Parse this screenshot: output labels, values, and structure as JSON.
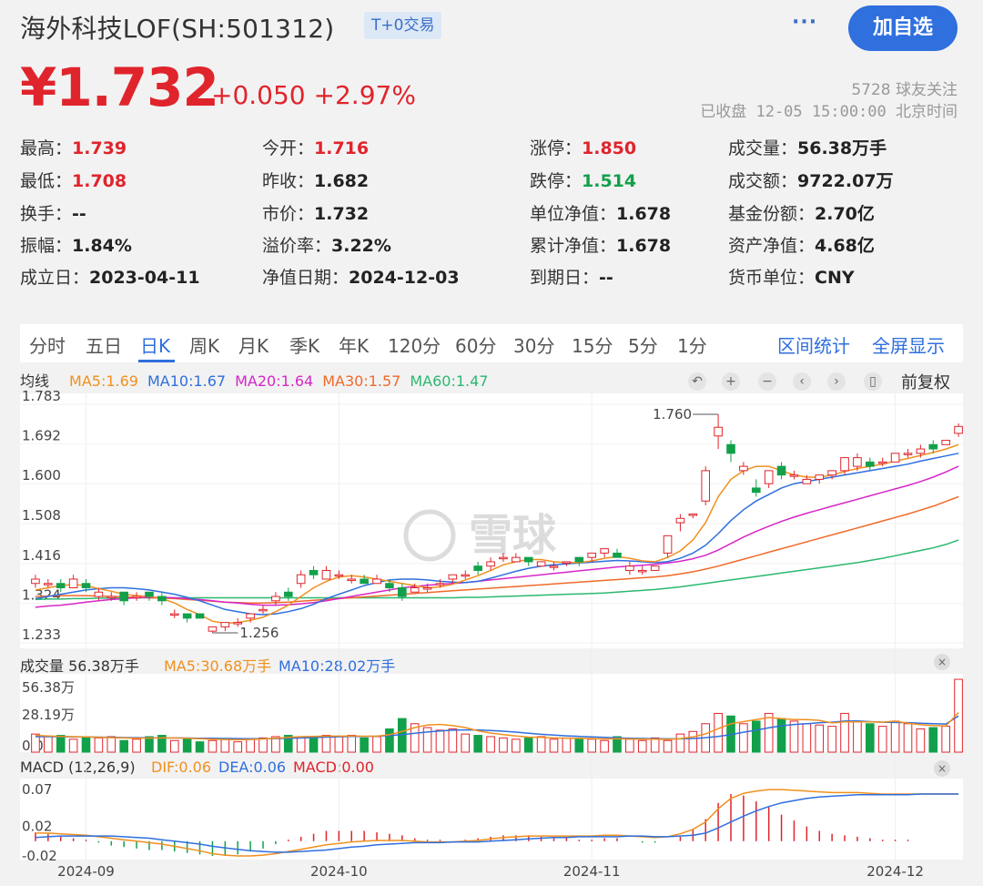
{
  "header": {
    "title": "海外科技LOF(SH:501312)",
    "badge": "T+0交易",
    "more_label": "···",
    "follow_label": "加自选"
  },
  "quote": {
    "price": "¥1.732",
    "change": "+0.050",
    "change_pct": "+2.97%",
    "followers": "5728 球友关注",
    "status": "已收盘 12-05 15:00:00 北京时间"
  },
  "stats": [
    [
      {
        "k": "最高：",
        "v": "1.739",
        "c": "red"
      },
      {
        "k": "今开：",
        "v": "1.716",
        "c": "red"
      },
      {
        "k": "涨停：",
        "v": "1.850",
        "c": "red"
      },
      {
        "k": "成交量：",
        "v": "56.38万手",
        "c": ""
      }
    ],
    [
      {
        "k": "最低：",
        "v": "1.708",
        "c": "red"
      },
      {
        "k": "昨收：",
        "v": "1.682",
        "c": ""
      },
      {
        "k": "跌停：",
        "v": "1.514",
        "c": "green"
      },
      {
        "k": "成交额：",
        "v": "9722.07万",
        "c": ""
      }
    ],
    [
      {
        "k": "换手：",
        "v": "--",
        "c": ""
      },
      {
        "k": "市价：",
        "v": "1.732",
        "c": ""
      },
      {
        "k": "单位净值：",
        "v": "1.678",
        "c": ""
      },
      {
        "k": "基金份额：",
        "v": "2.70亿",
        "c": ""
      }
    ],
    [
      {
        "k": "振幅：",
        "v": "1.84%",
        "c": ""
      },
      {
        "k": "溢价率：",
        "v": "3.22%",
        "c": ""
      },
      {
        "k": "累计净值：",
        "v": "1.678",
        "c": ""
      },
      {
        "k": "资产净值：",
        "v": "4.68亿",
        "c": ""
      }
    ],
    [
      {
        "k": "成立日：",
        "v": "2023-04-11",
        "c": ""
      },
      {
        "k": "净值日期：",
        "v": "2024-12-03",
        "c": ""
      },
      {
        "k": "到期日：",
        "v": "--",
        "c": ""
      },
      {
        "k": "货币单位：",
        "v": "CNY",
        "c": ""
      }
    ]
  ],
  "tabs": [
    "分时",
    "五日",
    "日K",
    "周K",
    "月K",
    "季K",
    "年K",
    "120分",
    "60分",
    "30分",
    "15分",
    "5分",
    "1分"
  ],
  "active_tab": "日K",
  "links": {
    "range_stats": "区间统计",
    "fullscreen": "全屏显示"
  },
  "ma_legend": {
    "label": "均线",
    "items": [
      {
        "text": "MA5:1.69",
        "color": "#f0901e"
      },
      {
        "text": "MA10:1.67",
        "color": "#2f6fde"
      },
      {
        "text": "MA20:1.64",
        "color": "#d627c8"
      },
      {
        "text": "MA30:1.57",
        "color": "#f06a2a"
      },
      {
        "text": "MA60:1.47",
        "color": "#2cb870"
      }
    ]
  },
  "controls": {
    "fq_label": "前复权",
    "icons": [
      "undo-icon",
      "zoom-in-icon",
      "zoom-out-icon",
      "pan-left-icon",
      "pan-right-icon",
      "candle-type-icon"
    ]
  },
  "watermark": "雪球",
  "chart_data": {
    "type": "candlestick",
    "y_ticks": [
      "1.783",
      "1.692",
      "1.600",
      "1.508",
      "1.416",
      "1.324",
      "1.233"
    ],
    "ylim": [
      1.233,
      1.783
    ],
    "x_ticks": [
      "2024-09",
      "2024-10",
      "2024-11",
      "2024-12"
    ],
    "annotations": {
      "high": "1.760",
      "low": "1.256"
    },
    "candles": [
      [
        1.37,
        1.38,
        1.36,
        1.39
      ],
      [
        1.37,
        1.37,
        1.36,
        1.38
      ],
      [
        1.37,
        1.36,
        1.35,
        1.38
      ],
      [
        1.36,
        1.38,
        1.36,
        1.39
      ],
      [
        1.37,
        1.36,
        1.35,
        1.38
      ],
      [
        1.34,
        1.35,
        1.33,
        1.36
      ],
      [
        1.34,
        1.34,
        1.33,
        1.35
      ],
      [
        1.35,
        1.33,
        1.32,
        1.35
      ],
      [
        1.34,
        1.34,
        1.33,
        1.35
      ],
      [
        1.35,
        1.34,
        1.33,
        1.35
      ],
      [
        1.34,
        1.33,
        1.32,
        1.35
      ],
      [
        1.3,
        1.3,
        1.29,
        1.31
      ],
      [
        1.3,
        1.29,
        1.28,
        1.3
      ],
      [
        1.3,
        1.29,
        1.29,
        1.3
      ],
      [
        1.26,
        1.27,
        1.256,
        1.27
      ],
      [
        1.27,
        1.28,
        1.26,
        1.28
      ],
      [
        1.28,
        1.28,
        1.27,
        1.29
      ],
      [
        1.29,
        1.3,
        1.28,
        1.3
      ],
      [
        1.31,
        1.31,
        1.3,
        1.32
      ],
      [
        1.33,
        1.34,
        1.32,
        1.35
      ],
      [
        1.35,
        1.34,
        1.33,
        1.36
      ],
      [
        1.37,
        1.39,
        1.36,
        1.4
      ],
      [
        1.4,
        1.39,
        1.38,
        1.41
      ],
      [
        1.38,
        1.4,
        1.38,
        1.41
      ],
      [
        1.39,
        1.39,
        1.38,
        1.4
      ],
      [
        1.38,
        1.38,
        1.37,
        1.39
      ],
      [
        1.38,
        1.37,
        1.37,
        1.39
      ],
      [
        1.37,
        1.38,
        1.37,
        1.39
      ],
      [
        1.37,
        1.36,
        1.35,
        1.38
      ],
      [
        1.36,
        1.34,
        1.33,
        1.37
      ],
      [
        1.35,
        1.36,
        1.35,
        1.37
      ],
      [
        1.36,
        1.36,
        1.35,
        1.37
      ],
      [
        1.37,
        1.37,
        1.36,
        1.38
      ],
      [
        1.38,
        1.39,
        1.37,
        1.39
      ],
      [
        1.39,
        1.39,
        1.38,
        1.4
      ],
      [
        1.41,
        1.4,
        1.39,
        1.42
      ],
      [
        1.41,
        1.42,
        1.4,
        1.43
      ],
      [
        1.43,
        1.43,
        1.42,
        1.44
      ],
      [
        1.42,
        1.43,
        1.42,
        1.44
      ],
      [
        1.43,
        1.42,
        1.41,
        1.43
      ],
      [
        1.41,
        1.42,
        1.41,
        1.42
      ],
      [
        1.41,
        1.41,
        1.4,
        1.42
      ],
      [
        1.42,
        1.42,
        1.41,
        1.42
      ],
      [
        1.43,
        1.42,
        1.41,
        1.43
      ],
      [
        1.43,
        1.44,
        1.42,
        1.44
      ],
      [
        1.44,
        1.45,
        1.43,
        1.45
      ],
      [
        1.44,
        1.43,
        1.43,
        1.45
      ],
      [
        1.4,
        1.41,
        1.39,
        1.42
      ],
      [
        1.4,
        1.4,
        1.39,
        1.41
      ],
      [
        1.4,
        1.41,
        1.4,
        1.41
      ],
      [
        1.44,
        1.48,
        1.43,
        1.48
      ],
      [
        1.51,
        1.52,
        1.49,
        1.53
      ],
      [
        1.53,
        1.53,
        1.52,
        1.53
      ],
      [
        1.56,
        1.63,
        1.55,
        1.64
      ],
      [
        1.71,
        1.73,
        1.68,
        1.76
      ],
      [
        1.69,
        1.67,
        1.65,
        1.7
      ],
      [
        1.63,
        1.64,
        1.62,
        1.65
      ],
      [
        1.59,
        1.58,
        1.57,
        1.61
      ],
      [
        1.6,
        1.63,
        1.59,
        1.63
      ],
      [
        1.64,
        1.62,
        1.61,
        1.65
      ],
      [
        1.62,
        1.62,
        1.61,
        1.63
      ],
      [
        1.6,
        1.61,
        1.6,
        1.62
      ],
      [
        1.61,
        1.62,
        1.6,
        1.62
      ],
      [
        1.62,
        1.63,
        1.61,
        1.63
      ],
      [
        1.63,
        1.66,
        1.62,
        1.66
      ],
      [
        1.64,
        1.66,
        1.63,
        1.67
      ],
      [
        1.65,
        1.64,
        1.63,
        1.66
      ],
      [
        1.65,
        1.65,
        1.64,
        1.66
      ],
      [
        1.65,
        1.67,
        1.65,
        1.67
      ],
      [
        1.67,
        1.67,
        1.66,
        1.68
      ],
      [
        1.67,
        1.68,
        1.66,
        1.69
      ],
      [
        1.69,
        1.68,
        1.67,
        1.7
      ],
      [
        1.69,
        1.7,
        1.69,
        1.7
      ],
      [
        1.716,
        1.732,
        1.708,
        1.739
      ]
    ],
    "ma5": [
      1.355,
      1.36,
      1.365,
      1.368,
      1.365,
      1.358,
      1.352,
      1.345,
      1.342,
      1.34,
      1.335,
      1.325,
      1.31,
      1.298,
      1.283,
      1.278,
      1.28,
      1.285,
      1.292,
      1.305,
      1.32,
      1.34,
      1.36,
      1.375,
      1.385,
      1.388,
      1.385,
      1.38,
      1.375,
      1.37,
      1.365,
      1.36,
      1.362,
      1.368,
      1.378,
      1.388,
      1.4,
      1.413,
      1.42,
      1.425,
      1.425,
      1.42,
      1.418,
      1.418,
      1.422,
      1.428,
      1.432,
      1.428,
      1.422,
      1.42,
      1.43,
      1.445,
      1.47,
      1.51,
      1.57,
      1.61,
      1.63,
      1.64,
      1.64,
      1.63,
      1.62,
      1.615,
      1.615,
      1.62,
      1.628,
      1.635,
      1.64,
      1.645,
      1.652,
      1.658,
      1.665,
      1.672,
      1.68,
      1.69
    ],
    "ma10": [
      1.335,
      1.34,
      1.345,
      1.35,
      1.355,
      1.358,
      1.36,
      1.36,
      1.358,
      1.355,
      1.35,
      1.345,
      1.338,
      1.33,
      1.32,
      1.31,
      1.305,
      1.3,
      1.298,
      1.3,
      1.305,
      1.312,
      1.322,
      1.335,
      1.345,
      1.355,
      1.365,
      1.372,
      1.378,
      1.38,
      1.38,
      1.378,
      1.375,
      1.373,
      1.372,
      1.375,
      1.382,
      1.39,
      1.398,
      1.405,
      1.41,
      1.413,
      1.415,
      1.417,
      1.419,
      1.421,
      1.423,
      1.422,
      1.42,
      1.418,
      1.42,
      1.428,
      1.44,
      1.458,
      1.485,
      1.515,
      1.54,
      1.56,
      1.575,
      1.59,
      1.6,
      1.605,
      1.61,
      1.615,
      1.62,
      1.625,
      1.63,
      1.635,
      1.64,
      1.645,
      1.652,
      1.658,
      1.664,
      1.67
    ],
    "ma20": [
      1.315,
      1.318,
      1.32,
      1.323,
      1.327,
      1.33,
      1.333,
      1.335,
      1.337,
      1.338,
      1.338,
      1.337,
      1.335,
      1.333,
      1.33,
      1.327,
      1.325,
      1.322,
      1.32,
      1.32,
      1.321,
      1.323,
      1.326,
      1.33,
      1.335,
      1.34,
      1.345,
      1.35,
      1.355,
      1.36,
      1.363,
      1.366,
      1.368,
      1.37,
      1.372,
      1.375,
      1.378,
      1.381,
      1.384,
      1.387,
      1.39,
      1.393,
      1.396,
      1.399,
      1.402,
      1.405,
      1.408,
      1.41,
      1.412,
      1.414,
      1.417,
      1.421,
      1.427,
      1.435,
      1.447,
      1.462,
      1.477,
      1.49,
      1.502,
      1.513,
      1.523,
      1.532,
      1.54,
      1.548,
      1.556,
      1.564,
      1.572,
      1.58,
      1.588,
      1.596,
      1.605,
      1.615,
      1.627,
      1.64
    ],
    "ma30": [
      1.34,
      1.341,
      1.342,
      1.342,
      1.342,
      1.341,
      1.34,
      1.339,
      1.338,
      1.337,
      1.336,
      1.335,
      1.333,
      1.331,
      1.329,
      1.327,
      1.326,
      1.325,
      1.325,
      1.326,
      1.327,
      1.329,
      1.331,
      1.333,
      1.335,
      1.337,
      1.339,
      1.341,
      1.343,
      1.345,
      1.347,
      1.349,
      1.351,
      1.353,
      1.355,
      1.357,
      1.359,
      1.361,
      1.363,
      1.365,
      1.367,
      1.369,
      1.371,
      1.373,
      1.375,
      1.377,
      1.379,
      1.381,
      1.383,
      1.385,
      1.388,
      1.392,
      1.397,
      1.403,
      1.41,
      1.418,
      1.426,
      1.434,
      1.442,
      1.45,
      1.458,
      1.466,
      1.474,
      1.482,
      1.49,
      1.498,
      1.506,
      1.514,
      1.522,
      1.53,
      1.539,
      1.548,
      1.559,
      1.57
    ],
    "ma60": [
      1.333,
      1.334,
      1.334,
      1.335,
      1.335,
      1.336,
      1.336,
      1.336,
      1.337,
      1.337,
      1.337,
      1.337,
      1.337,
      1.337,
      1.337,
      1.337,
      1.337,
      1.337,
      1.337,
      1.337,
      1.337,
      1.337,
      1.337,
      1.337,
      1.337,
      1.337,
      1.337,
      1.337,
      1.337,
      1.337,
      1.337,
      1.337,
      1.337,
      1.337,
      1.338,
      1.338,
      1.339,
      1.34,
      1.341,
      1.342,
      1.343,
      1.344,
      1.345,
      1.346,
      1.347,
      1.348,
      1.35,
      1.352,
      1.354,
      1.356,
      1.359,
      1.362,
      1.366,
      1.37,
      1.374,
      1.378,
      1.382,
      1.386,
      1.39,
      1.394,
      1.398,
      1.402,
      1.406,
      1.41,
      1.414,
      1.418,
      1.423,
      1.428,
      1.434,
      1.44,
      1.446,
      1.452,
      1.46,
      1.47
    ],
    "volume": {
      "label": "成交量 56.38万手",
      "ma5_label": "MA5:30.68万手",
      "ma10_label": "MA10:28.02万手",
      "y_ticks": [
        "56.38万",
        "28.19万",
        "0.00"
      ],
      "max": 56.38,
      "values": [
        14,
        12,
        13,
        10,
        12,
        11,
        12,
        9,
        10,
        12,
        13,
        9,
        10,
        8,
        9,
        10,
        8,
        10,
        11,
        12,
        13,
        12,
        12,
        13,
        12,
        13,
        11,
        12,
        18,
        26,
        22,
        19,
        17,
        18,
        14,
        13,
        12,
        11,
        10,
        11,
        12,
        10,
        11,
        10,
        10,
        9,
        12,
        10,
        9,
        11,
        9,
        14,
        16,
        22,
        30,
        28,
        22,
        24,
        30,
        26,
        24,
        22,
        21,
        20,
        30,
        24,
        22,
        20,
        24,
        22,
        18,
        19,
        20,
        56.38
      ],
      "ma5": [
        13,
        12.5,
        12.2,
        12,
        11.8,
        11.5,
        11.2,
        11,
        10.8,
        10.9,
        11,
        11,
        10.8,
        10.4,
        10,
        9.8,
        9.6,
        9.8,
        10.2,
        10.8,
        11.5,
        12,
        12.2,
        12.4,
        12.4,
        12.5,
        12.3,
        12.3,
        13.5,
        16,
        19,
        21,
        21.5,
        20.5,
        19,
        16.5,
        14.8,
        13.6,
        12.5,
        11.6,
        11.4,
        11,
        10.8,
        10.7,
        10.5,
        10.2,
        10.4,
        10.2,
        10.1,
        10.1,
        9.9,
        10.4,
        11.8,
        14.2,
        18.2,
        22,
        23.6,
        25.2,
        26.8,
        26,
        25.2,
        25.2,
        24.6,
        22.6,
        23.4,
        23.4,
        23.4,
        23.2,
        24,
        22.4,
        21.2,
        20.6,
        20.2,
        30.68
      ],
      "ma10": [
        12,
        12,
        12,
        11.8,
        11.7,
        11.6,
        11.5,
        11.3,
        11.2,
        11.1,
        11,
        11,
        10.9,
        10.8,
        10.7,
        10.6,
        10.5,
        10.4,
        10.4,
        10.5,
        10.7,
        11,
        11.3,
        11.6,
        11.9,
        12.1,
        12.2,
        12.3,
        12.8,
        13.6,
        14.6,
        15.6,
        16.4,
        17,
        17.2,
        17.2,
        16.8,
        16.2,
        15.5,
        14.6,
        13.8,
        13.2,
        12.6,
        12.2,
        11.8,
        11.4,
        11,
        10.8,
        10.6,
        10.4,
        10.3,
        10.3,
        10.6,
        11.2,
        12.2,
        13.6,
        15.4,
        17,
        18.8,
        20.4,
        21.4,
        22,
        22.8,
        23.2,
        24,
        24.2,
        23.6,
        23.2,
        23,
        22.8,
        22.4,
        22,
        21.8,
        28.02
      ]
    },
    "macd": {
      "label": "MACD (12,26,9)",
      "dif_label": "DIF:0.06",
      "dea_label": "DEA:0.06",
      "macd_label": "MACD:0.00",
      "y_ticks": [
        "0.07",
        "0.02",
        "-0.02"
      ],
      "ylim": [
        -0.025,
        0.085
      ],
      "dif": [
        0.011,
        0.011,
        0.01,
        0.009,
        0.008,
        0.006,
        0.004,
        0.002,
        0.0,
        -0.002,
        -0.004,
        -0.007,
        -0.01,
        -0.013,
        -0.017,
        -0.019,
        -0.02,
        -0.02,
        -0.019,
        -0.017,
        -0.014,
        -0.011,
        -0.008,
        -0.005,
        -0.003,
        -0.001,
        0.0,
        0.001,
        0.001,
        0.001,
        0.0,
        -0.001,
        -0.001,
        -0.001,
        0.0,
        0.001,
        0.003,
        0.005,
        0.006,
        0.007,
        0.007,
        0.007,
        0.007,
        0.007,
        0.007,
        0.008,
        0.008,
        0.007,
        0.006,
        0.005,
        0.006,
        0.01,
        0.016,
        0.026,
        0.044,
        0.058,
        0.065,
        0.068,
        0.07,
        0.07,
        0.069,
        0.068,
        0.067,
        0.066,
        0.066,
        0.066,
        0.065,
        0.064,
        0.064,
        0.064,
        0.064,
        0.064,
        0.064,
        0.064
      ],
      "dea": [
        0.005,
        0.006,
        0.007,
        0.007,
        0.007,
        0.007,
        0.007,
        0.006,
        0.005,
        0.004,
        0.002,
        0.0,
        -0.002,
        -0.004,
        -0.007,
        -0.009,
        -0.011,
        -0.013,
        -0.014,
        -0.015,
        -0.015,
        -0.014,
        -0.013,
        -0.012,
        -0.01,
        -0.008,
        -0.007,
        -0.005,
        -0.004,
        -0.003,
        -0.002,
        -0.002,
        -0.002,
        -0.001,
        -0.001,
        -0.001,
        0.0,
        0.001,
        0.002,
        0.003,
        0.004,
        0.005,
        0.005,
        0.006,
        0.006,
        0.006,
        0.006,
        0.007,
        0.007,
        0.006,
        0.006,
        0.007,
        0.008,
        0.011,
        0.018,
        0.026,
        0.034,
        0.041,
        0.047,
        0.052,
        0.055,
        0.058,
        0.06,
        0.061,
        0.062,
        0.063,
        0.063,
        0.063,
        0.063,
        0.063,
        0.064,
        0.064,
        0.064,
        0.064
      ]
    }
  }
}
